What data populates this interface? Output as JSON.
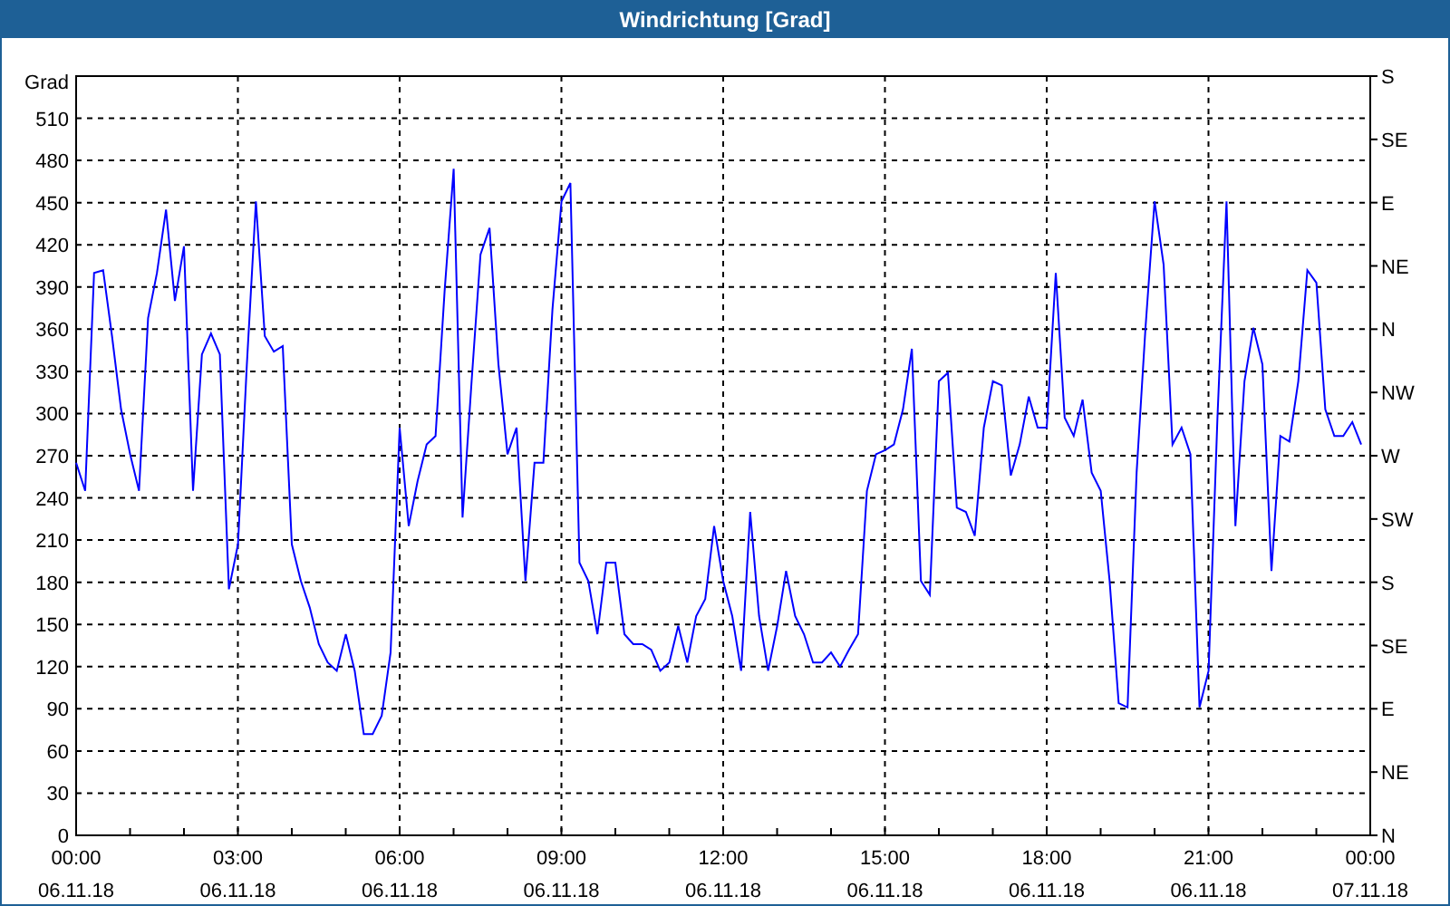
{
  "window": {
    "title": "Windrichtung [Grad]"
  },
  "chart": {
    "chart_data": {
      "type": "line",
      "ylabel": "Grad",
      "categories": [
        "00:00\n06.11.18",
        null,
        null,
        null,
        null,
        null,
        null,
        null,
        null,
        null,
        null,
        null,
        null,
        null,
        null,
        null,
        null,
        null,
        "03:00\n06.11.18",
        null,
        null,
        null,
        null,
        null,
        null,
        null,
        null,
        null,
        null,
        null,
        null,
        null,
        null,
        null,
        null,
        null,
        "06:00\n06.11.18",
        null,
        null,
        null,
        null,
        null,
        null,
        null,
        null,
        null,
        null,
        null,
        null,
        null,
        null,
        null,
        null,
        null,
        "09:00\n06.11.18",
        null,
        null,
        null,
        null,
        null,
        null,
        null,
        null,
        null,
        null,
        null,
        null,
        null,
        null,
        null,
        null,
        null,
        "12:00\n06.11.18",
        null,
        null,
        null,
        null,
        null,
        null,
        null,
        null,
        null,
        null,
        null,
        null,
        null,
        null,
        null,
        null,
        null,
        "15:00\n06.11.18",
        null,
        null,
        null,
        null,
        null,
        null,
        null,
        null,
        null,
        null,
        null,
        null,
        null,
        null,
        null,
        null,
        null,
        "18:00\n06.11.18",
        null,
        null,
        null,
        null,
        null,
        null,
        null,
        null,
        null,
        null,
        null,
        null,
        null,
        null,
        null,
        null,
        null,
        "21:00\n06.11.18",
        null,
        null,
        null,
        null,
        null,
        null,
        null,
        null,
        null,
        null,
        null,
        null,
        null,
        null,
        null,
        null,
        null,
        "00:00\n07.11.18"
      ],
      "series": [
        {
          "color": "#0000ff",
          "values": [
            265,
            245,
            400,
            402,
            355,
            303,
            271,
            245,
            368,
            400,
            445,
            380,
            419,
            245,
            342,
            357,
            342,
            175,
            207,
            335,
            451,
            355,
            344,
            348,
            207,
            181,
            162,
            136,
            123,
            117,
            143,
            117,
            72,
            72,
            85,
            130,
            290,
            220,
            252,
            278,
            284,
            387,
            474,
            226,
            323,
            413,
            432,
            335,
            271,
            290,
            181,
            265,
            265,
            374,
            451,
            464,
            194,
            181,
            143,
            194,
            194,
            143,
            136,
            136,
            132,
            117,
            123,
            149,
            123,
            156,
            168,
            220,
            181,
            156,
            117,
            230,
            156,
            117,
            149,
            188,
            156,
            143,
            123,
            123,
            130,
            120,
            132,
            143,
            245,
            271,
            274,
            278,
            303,
            346,
            181,
            171,
            323,
            329,
            233,
            230,
            213,
            290,
            323,
            320,
            256,
            278,
            312,
            290,
            290,
            400,
            297,
            284,
            310,
            258,
            245,
            181,
            94,
            91,
            258,
            361,
            451,
            406,
            278,
            290,
            271,
            91,
            117,
            297,
            451,
            220,
            323,
            361,
            335,
            188,
            284,
            280,
            323,
            402,
            393,
            303,
            284,
            284,
            294,
            278,
            null
          ]
        }
      ],
      "ylim": [
        0,
        540
      ],
      "grid": true,
      "yticks": [
        0,
        30,
        60,
        90,
        120,
        150,
        180,
        210,
        240,
        270,
        300,
        330,
        360,
        390,
        420,
        450,
        480,
        510
      ]
    },
    "direction_axis": [
      "S",
      "SE",
      "E",
      "NE",
      "N",
      "NW",
      "W",
      "SW",
      "S",
      "SE",
      "E",
      "NE",
      "N"
    ]
  }
}
